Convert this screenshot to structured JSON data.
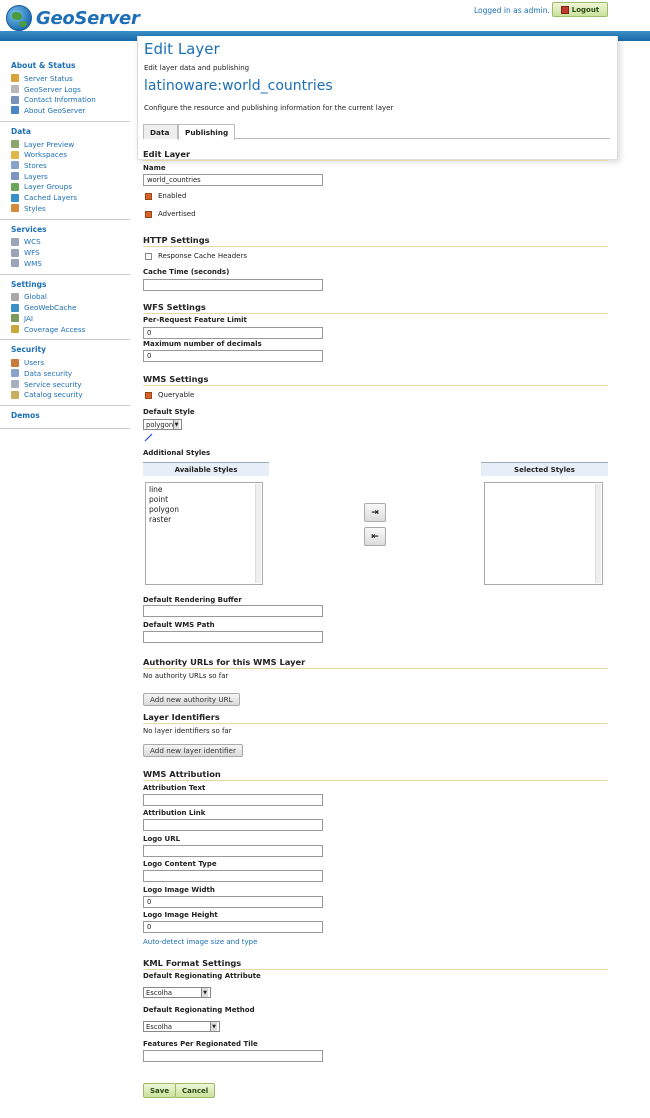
{
  "app": {
    "name": "GeoServer",
    "logged_in": "Logged in as admin.",
    "logout": "Logout"
  },
  "sidebar": [
    {
      "title": "About & Status",
      "items": [
        {
          "label": "Server Status",
          "icon": "server-status-icon",
          "color": "#d9a33a"
        },
        {
          "label": "GeoServer Logs",
          "icon": "logs-icon",
          "color": "#b8b8b8"
        },
        {
          "label": "Contact Information",
          "icon": "contact-icon",
          "color": "#7a92b8"
        },
        {
          "label": "About GeoServer",
          "icon": "about-icon",
          "color": "#4a86c5"
        }
      ]
    },
    {
      "title": "Data",
      "items": [
        {
          "label": "Layer Preview",
          "icon": "layer-preview-icon",
          "color": "#8aa66a"
        },
        {
          "label": "Workspaces",
          "icon": "workspaces-icon",
          "color": "#e0b84a"
        },
        {
          "label": "Stores",
          "icon": "stores-icon",
          "color": "#8aa3c8"
        },
        {
          "label": "Layers",
          "icon": "layers-icon",
          "color": "#7d95c0"
        },
        {
          "label": "Layer Groups",
          "icon": "layer-groups-icon",
          "color": "#6aa65a"
        },
        {
          "label": "Cached Layers",
          "icon": "cached-layers-icon",
          "color": "#3a8fc7"
        },
        {
          "label": "Styles",
          "icon": "styles-icon",
          "color": "#d58a3a"
        }
      ]
    },
    {
      "title": "Services",
      "items": [
        {
          "label": "WCS",
          "icon": "wcs-icon",
          "color": "#9aa5b8"
        },
        {
          "label": "WFS",
          "icon": "wfs-icon",
          "color": "#9aa5b8"
        },
        {
          "label": "WMS",
          "icon": "wms-icon",
          "color": "#9aa5b8"
        }
      ]
    },
    {
      "title": "Settings",
      "items": [
        {
          "label": "Global",
          "icon": "global-icon",
          "color": "#a8a8a8"
        },
        {
          "label": "GeoWebCache",
          "icon": "geowebcache-icon",
          "color": "#3a8fc7"
        },
        {
          "label": "JAI",
          "icon": "jai-icon",
          "color": "#7a9a5a"
        },
        {
          "label": "Coverage Access",
          "icon": "coverage-access-icon",
          "color": "#c8a83a"
        }
      ]
    },
    {
      "title": "Security",
      "items": [
        {
          "label": "Users",
          "icon": "users-icon",
          "color": "#c77a3a"
        },
        {
          "label": "Data security",
          "icon": "data-security-icon",
          "color": "#8aa3c8"
        },
        {
          "label": "Service security",
          "icon": "service-security-icon",
          "color": "#a8b0c0"
        },
        {
          "label": "Catalog security",
          "icon": "catalog-security-icon",
          "color": "#c8b060"
        }
      ]
    },
    {
      "title": "Demos",
      "items": []
    }
  ],
  "page": {
    "title": "Edit Layer",
    "subtitle": "Edit layer data and publishing",
    "layer": "latinoware:world_countries",
    "description": "Configure the resource and publishing information for the current layer"
  },
  "tabs": [
    "Data",
    "Publishing"
  ],
  "edit_layer": {
    "heading": "Edit Layer",
    "name_label": "Name",
    "name_value": "world_countries",
    "enabled": "Enabled",
    "advertised": "Advertised"
  },
  "http": {
    "heading": "HTTP Settings",
    "cache_headers": "Response Cache Headers",
    "cache_time_label": "Cache Time (seconds)",
    "cache_time_value": ""
  },
  "wfs": {
    "heading": "WFS Settings",
    "limit_label": "Per-Request Feature Limit",
    "limit_value": "0",
    "decimals_label": "Maximum number of decimals",
    "decimals_value": "0"
  },
  "wms": {
    "heading": "WMS Settings",
    "queryable": "Queryable",
    "default_style_label": "Default Style",
    "default_style_value": "polygon",
    "additional_styles": "Additional Styles",
    "available_header": "Available Styles",
    "selected_header": "Selected Styles",
    "available": [
      "line",
      "point",
      "polygon",
      "raster"
    ],
    "selected": [],
    "buffer_label": "Default Rendering Buffer",
    "buffer_value": "",
    "path_label": "Default WMS Path",
    "path_value": ""
  },
  "authority": {
    "heading": "Authority URLs for this WMS Layer",
    "empty": "No authority URLs so far",
    "add": "Add new authority URL"
  },
  "identifiers": {
    "heading": "Layer Identifiers",
    "empty": "No layer identifiers so far",
    "add": "Add new layer identifier"
  },
  "attribution": {
    "heading": "WMS Attribution",
    "text_label": "Attribution Text",
    "text_value": "",
    "link_label": "Attribution Link",
    "link_value": "",
    "logo_url_label": "Logo URL",
    "logo_url_value": "",
    "logo_type_label": "Logo Content Type",
    "logo_type_value": "",
    "logo_width_label": "Logo Image Width",
    "logo_width_value": "0",
    "logo_height_label": "Logo Image Height",
    "logo_height_value": "0",
    "autodetect": "Auto-detect image size and type"
  },
  "kml": {
    "heading": "KML Format Settings",
    "attr_label": "Default Regionating Attribute",
    "attr_value": "Escolha",
    "method_label": "Default Regionating Method",
    "method_value": "Escolha",
    "features_label": "Features Per Regionated Tile",
    "features_value": ""
  },
  "actions": {
    "save": "Save",
    "cancel": "Cancel"
  }
}
